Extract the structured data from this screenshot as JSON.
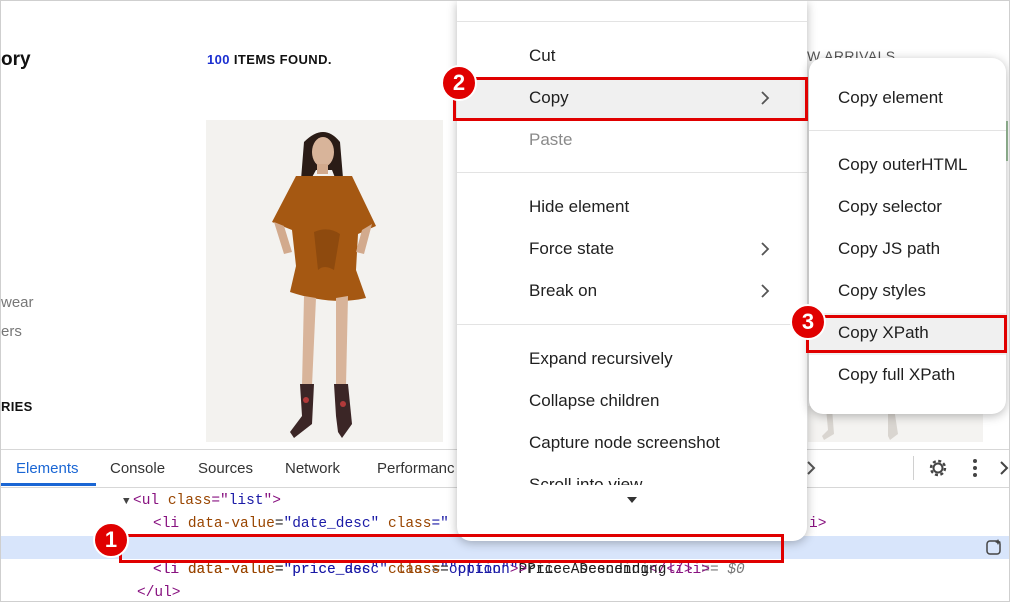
{
  "storefront": {
    "title_fragment": "ory",
    "sidebar_fragments": [
      "wear",
      "ers"
    ],
    "sidebar_bold_fragment": "RIES",
    "items_count": "100",
    "items_found_label": "ITEMS FOUND.",
    "sort_fragment": "W ARRIVALS"
  },
  "devtools": {
    "tabs": [
      "Elements",
      "Console",
      "Sources",
      "Network",
      "Performanc"
    ],
    "active_tab": "Elements",
    "icons": [
      "more-tabs-chevron-icon",
      "settings-gear-icon",
      "kebab-menu-icon",
      "close-icon",
      "ai-assist-icon"
    ],
    "code": {
      "line1": {
        "open": "<ul ",
        "attr": "class",
        "eqq": "=\"",
        "val": "list",
        "close": "\">"
      },
      "line2": {
        "open": "<li ",
        "a1": "data-value",
        "v1": "\"date_desc\"",
        "a2": "class",
        "rest": "=\"",
        "tail": "i>"
      },
      "line3": {
        "open": "<li ",
        "a1": "data-value",
        "v1": "\"price_asc\"",
        "a2": "class",
        "v2": "\"option\"",
        "gt": ">",
        "text": "Price Ascending",
        "endtag": "</li>",
        "ref": "== $0"
      },
      "line4": {
        "open": "<li ",
        "a1": "data-value",
        "v1": "\"price_desc\"",
        "a2": "class",
        "v2": "\"option\"",
        "gt": ">",
        "text": "Price Descending",
        "endtag": "</li>"
      },
      "line5": {
        "close": "</ul>"
      }
    }
  },
  "context_menu": {
    "items": [
      "Cut",
      "Copy",
      "Paste",
      "Hide element",
      "Force state",
      "Break on",
      "Expand recursively",
      "Collapse children",
      "Capture node screenshot",
      "Scroll into view"
    ],
    "disabled": [
      "Paste"
    ],
    "highlighted": "Copy",
    "submenu_items": [
      "Copy element",
      "Copy outerHTML",
      "Copy selector",
      "Copy JS path",
      "Copy styles",
      "Copy XPath",
      "Copy full XPath"
    ]
  },
  "annotations": {
    "steps": [
      "1",
      "2",
      "3"
    ],
    "color": "#e00000"
  },
  "colors": {
    "accent_blue": "#1a66d4",
    "count_blue": "#1a2ed1",
    "selected_row": "#d8e5fb",
    "tag": "#881280",
    "attribute": "#994500",
    "value": "#1a1aa6"
  }
}
